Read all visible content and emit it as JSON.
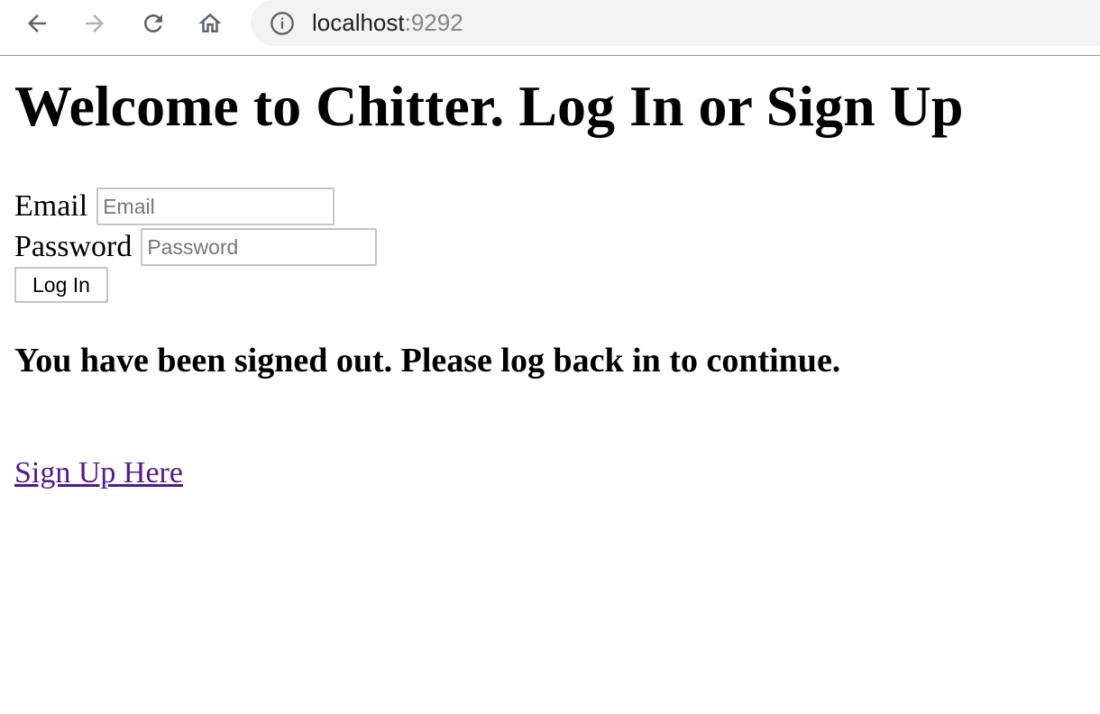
{
  "browser": {
    "url_host": "localhost",
    "url_port": ":9292",
    "icons": {
      "back": "arrow-left-icon",
      "forward": "arrow-right-icon",
      "reload": "reload-icon",
      "home": "home-icon",
      "info": "info-icon"
    }
  },
  "page": {
    "title": "Welcome to Chitter. Log In or Sign Up",
    "login_form": {
      "email_label": "Email",
      "email_placeholder": "Email",
      "password_label": "Password",
      "password_placeholder": "Password",
      "submit_label": "Log In"
    },
    "status_message": "You have been signed out. Please log back in to continue.",
    "signup_link": "Sign Up Here"
  },
  "colors": {
    "visited_link": "#551a8b",
    "omnibox_bg": "#f1f3f4"
  }
}
